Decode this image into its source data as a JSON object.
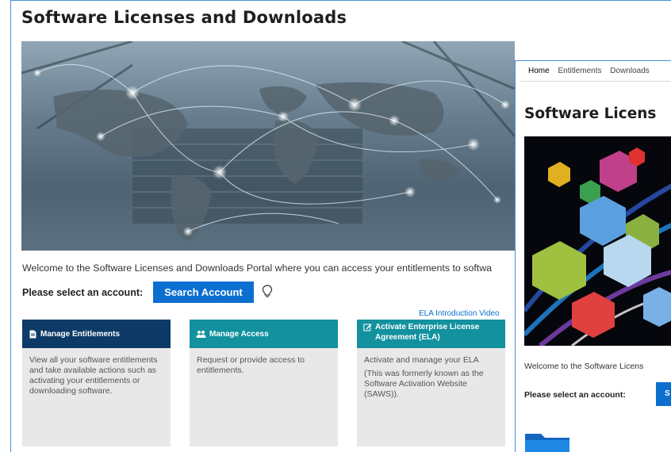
{
  "page": {
    "title": "Software Licenses and Downloads",
    "welcome_text": "Welcome to the Software Licenses and Downloads Portal where you can access your entitlements to softwa",
    "select_account_label": "Please select an account:",
    "search_button_label": "Search Account",
    "ela_video_link": "ELA Introduction Video"
  },
  "cards": [
    {
      "title": "Manage Entitlements",
      "icon": "document-icon",
      "color": "#0d3a66",
      "body": [
        "View all your software entitlements and take available actions such as activating your entitlements or downloading software."
      ]
    },
    {
      "title": "Manage Access",
      "icon": "users-icon",
      "color": "#13919e",
      "body": [
        "Request or provide access to entitlements."
      ]
    },
    {
      "title": "Activate Enterprise License Agreement (ELA)",
      "icon": "edit-icon",
      "color": "#13919e",
      "body": [
        "Activate and manage your ELA",
        "(This was formerly known as the Software Activation Website (SAWS))."
      ]
    }
  ],
  "overlay": {
    "nav": [
      "Home",
      "Entitlements",
      "Downloads"
    ],
    "title": "Software Licens",
    "welcome_text": "Welcome to the Software Licens",
    "select_account_label": "Please select an account:",
    "search_button_partial": "S"
  },
  "colors": {
    "accent": "#0b6fd0",
    "card_dark": "#0d3a66",
    "card_teal": "#13919e",
    "card_bg": "#e8e8e8"
  }
}
